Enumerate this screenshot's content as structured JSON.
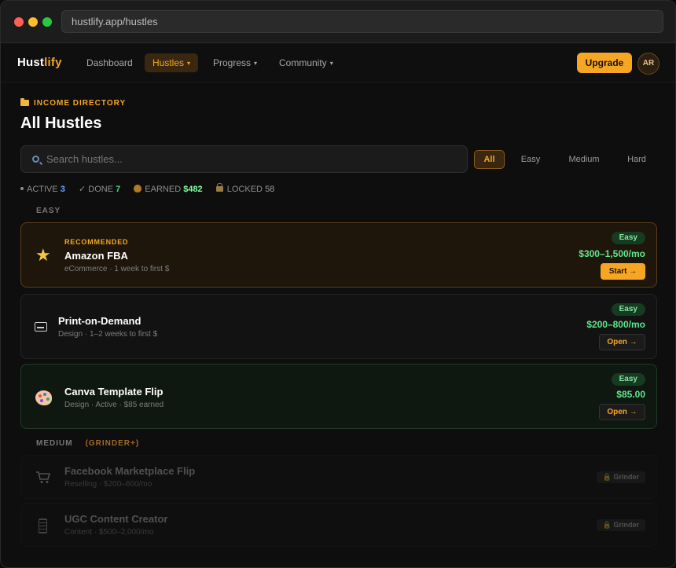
{
  "browser": {
    "url": "hustlify.app/hustles"
  },
  "nav": {
    "logo_main": "Hust",
    "logo_accent": "lify",
    "items": [
      {
        "label": "Dashboard",
        "caret": ""
      },
      {
        "label": "Hustles",
        "caret": "▾"
      },
      {
        "label": "Progress",
        "caret": "▾"
      },
      {
        "label": "Community",
        "caret": "▾"
      }
    ],
    "active_item": "Hustles",
    "upgrade_label": "Upgrade",
    "avatar_initials": "AR"
  },
  "page": {
    "eyebrow": "INCOME DIRECTORY",
    "title": "All Hustles"
  },
  "search": {
    "placeholder": "Search hustles..."
  },
  "filters": [
    "All",
    "Easy",
    "Medium",
    "Hard"
  ],
  "active_filter": "All",
  "stats": {
    "active_label": "ACTIVE",
    "active_value": "3",
    "done_label": "✓ DONE",
    "done_value": "7",
    "earned_label": "EARNED",
    "earned_value": "$482",
    "locked_label": "LOCKED",
    "locked_value": "58"
  },
  "sections": {
    "easy_label": "EASY",
    "medium_label": "MEDIUM",
    "medium_tag": "(GRINDER+)"
  },
  "hustles": [
    {
      "kicker": "RECOMMENDED",
      "name": "Amazon FBA",
      "meta": "eCommerce · 1 week to first $",
      "difficulty": "Easy",
      "price": "$300–1,500/mo",
      "action": "Start →",
      "icon": "star-icon"
    },
    {
      "name": "Print-on-Demand",
      "meta": "Design · 1–2 weeks to first $",
      "difficulty": "Easy",
      "price": "$200–800/mo",
      "action": "Open →",
      "icon": "monitor-icon"
    },
    {
      "name": "Canva Template Flip",
      "meta": "Design · Active · $85 earned",
      "difficulty": "Easy",
      "price": "$85.00",
      "action": "Open →",
      "icon": "palette-icon"
    },
    {
      "name": "Facebook Marketplace Flip",
      "meta": "Reselling · $200–600/mo",
      "lock": "🔒 Grinder",
      "icon": "cart-icon"
    },
    {
      "name": "UGC Content Creator",
      "meta": "Content · $500–2,000/mo",
      "lock": "🔒 Grinder",
      "icon": "phone-icon"
    }
  ],
  "colors": {
    "accent": "#f6a623",
    "success": "#5ee88c",
    "background": "#0e0e0e"
  }
}
